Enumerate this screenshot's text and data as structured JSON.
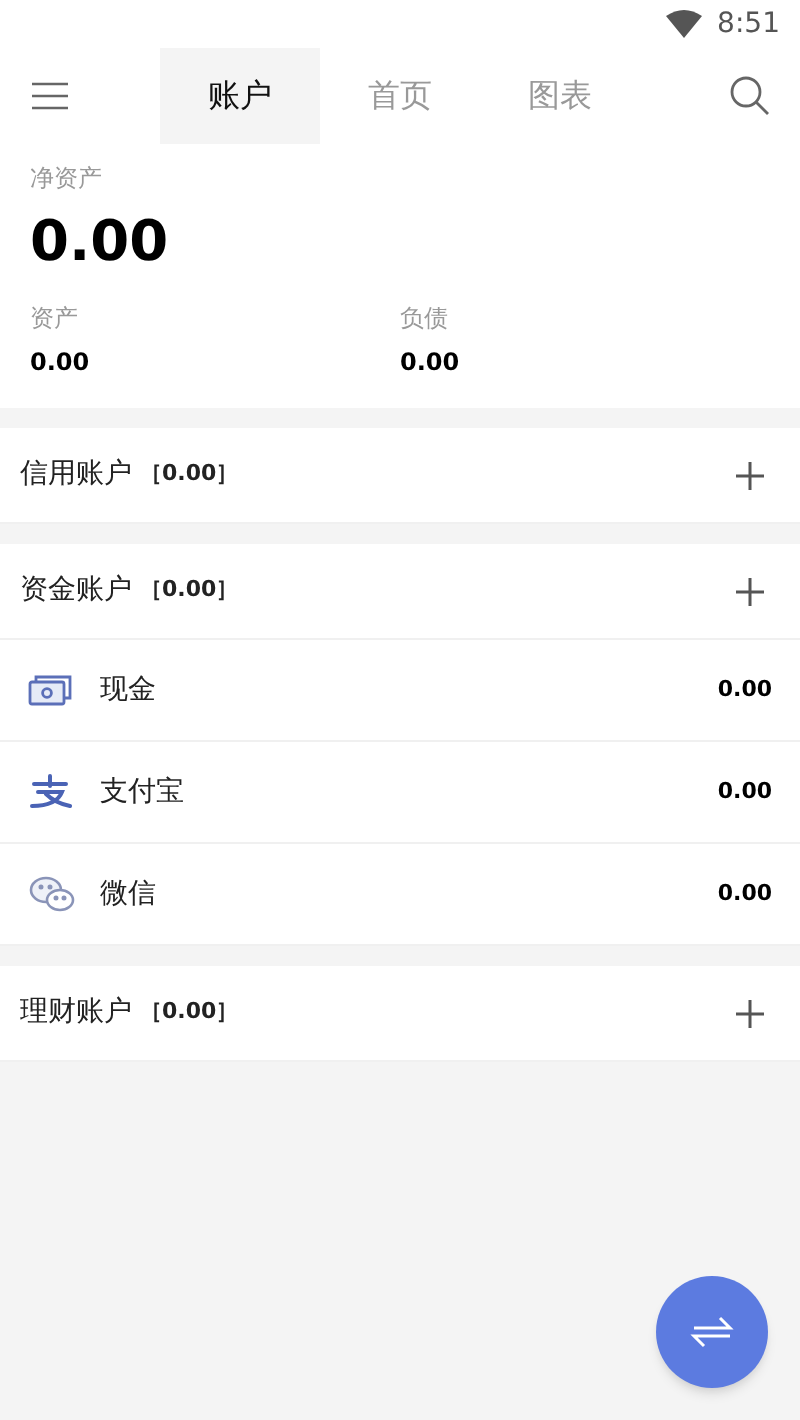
{
  "status_bar": {
    "time": "8:51"
  },
  "tabs": [
    {
      "label": "账户",
      "selected": true
    },
    {
      "label": "首页",
      "selected": false
    },
    {
      "label": "图表",
      "selected": false
    }
  ],
  "summary": {
    "net_label": "净资产",
    "net_value": "0.00",
    "assets_label": "资产",
    "assets_value": "0.00",
    "liabilities_label": "负债",
    "liabilities_value": "0.00"
  },
  "groups": [
    {
      "title": "信用账户",
      "total": "［0.00］"
    },
    {
      "title": "资金账户",
      "total": "［0.00］",
      "items": [
        {
          "kind": "cash",
          "name": "现金",
          "amount": "0.00"
        },
        {
          "kind": "alipay",
          "name": "支付宝",
          "amount": "0.00"
        },
        {
          "kind": "wechat",
          "name": "微信",
          "amount": "0.00"
        }
      ]
    },
    {
      "title": "理财账户",
      "total": "［0.00］"
    }
  ]
}
